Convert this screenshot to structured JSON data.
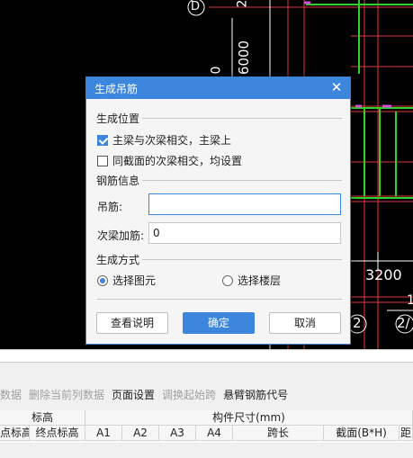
{
  "canvas": {
    "labels": {
      "axis_d": "D",
      "dim_6000": "6000",
      "dim_0": "0",
      "dim_3200": "3200",
      "num_2": "2",
      "num_2_slash": "2/",
      "num_1": "1",
      "top_2": "2"
    },
    "colors": {
      "line_red": "#e23a3a",
      "line_green": "#2fd12f",
      "line_magenta": "#d14fd1",
      "line_white": "#ffffff"
    }
  },
  "dialog": {
    "title": "生成吊筋",
    "close_icon": "close-icon",
    "section_position": "生成位置",
    "option_main_secondary": "主梁与次梁相交，主梁上",
    "option_main_secondary_checked": true,
    "option_same_section": "同截面的次梁相交，均设置",
    "option_same_section_checked": false,
    "section_rebar_info": "钢筋信息",
    "hanger_label": "吊筋:",
    "hanger_value": "",
    "secondary_rebar_label": "次梁加筋:",
    "secondary_rebar_value": "0",
    "section_method": "生成方式",
    "radio_select_element": "选择图元",
    "radio_select_element_checked": true,
    "radio_select_floor": "选择楼层",
    "radio_select_floor_checked": false,
    "help_button": "查看说明",
    "ok_button": "确定",
    "cancel_button": "取消",
    "accent_color": "#3d86de"
  },
  "panel": {
    "toolbar": {
      "item_partial": "数据",
      "delete_current_row": "删除当前列数据",
      "page_setup": "页面设置",
      "adjust_start_span": "调换起始跨",
      "cantilever_code": "悬臂钢筋代号"
    },
    "grid": {
      "header_elevation": "标高",
      "header_component_size": "构件尺寸(mm)",
      "col_start_elev": "点标高",
      "col_end_elev": "终点标高",
      "col_a1": "A1",
      "col_a2": "A2",
      "col_a3": "A3",
      "col_a4": "A4",
      "col_span": "跨长",
      "col_section": "截面(B*H)",
      "col_dist": "距"
    }
  }
}
